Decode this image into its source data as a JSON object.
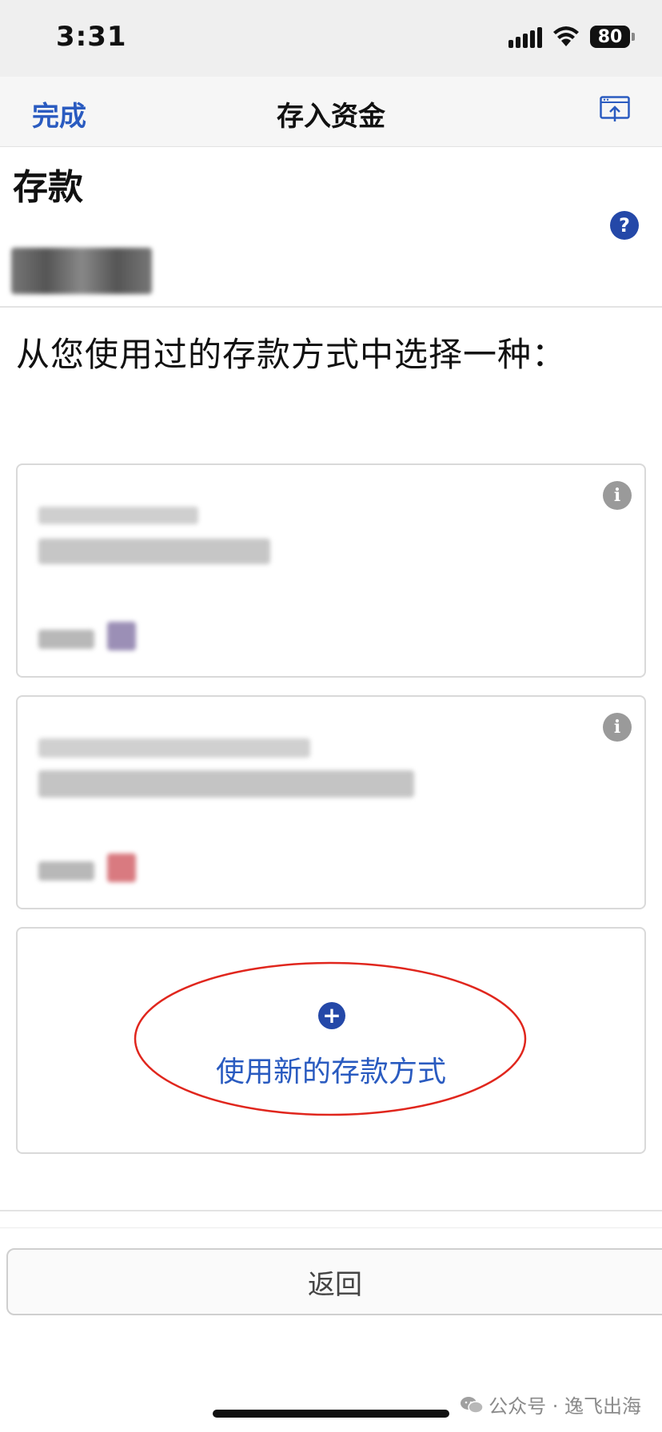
{
  "status_bar": {
    "time": "3:31",
    "battery": "80",
    "icons": [
      "cellular-signal-icon",
      "wifi-icon",
      "battery-icon"
    ]
  },
  "nav": {
    "done_label": "完成",
    "title": "存入资金",
    "share_icon": "share-window-icon"
  },
  "page": {
    "heading": "存款",
    "help_glyph": "?",
    "prompt": "从您使用过的存款方式中选择一种："
  },
  "methods": {
    "saved": [
      {
        "info_glyph": "i",
        "accent": "#9b8fb6"
      },
      {
        "info_glyph": "i",
        "accent": "#d97a80"
      }
    ],
    "new_method": {
      "plus_glyph": "+",
      "label": "使用新的存款方式"
    },
    "highlight_color": "#e0261d"
  },
  "footer": {
    "back_label": "返回"
  },
  "watermark": {
    "text": "公众号 · 逸飞出海"
  },
  "colors": {
    "accent": "#2a5bc0",
    "icon_blue": "#2448a8"
  }
}
